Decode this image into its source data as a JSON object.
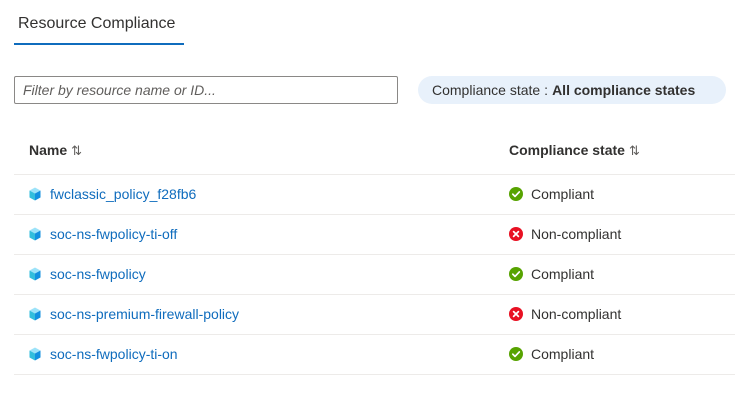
{
  "tabs": [
    {
      "label": "Resource Compliance",
      "active": true
    }
  ],
  "filter": {
    "placeholder": "Filter by resource name or ID...",
    "value": ""
  },
  "compliance_filter": {
    "label": "Compliance state",
    "separator": ":",
    "value": "All compliance states"
  },
  "table": {
    "columns": [
      {
        "label": "Name",
        "sort_icon": "⇅"
      },
      {
        "label": "Compliance state",
        "sort_icon": "⇅"
      }
    ],
    "rows": [
      {
        "name": "fwclassic_policy_f28fb6",
        "state": "Compliant",
        "status": "compliant"
      },
      {
        "name": "soc-ns-fwpolicy-ti-off",
        "state": "Non-compliant",
        "status": "non-compliant"
      },
      {
        "name": "soc-ns-fwpolicy",
        "state": "Compliant",
        "status": "compliant"
      },
      {
        "name": "soc-ns-premium-firewall-policy",
        "state": "Non-compliant",
        "status": "non-compliant"
      },
      {
        "name": "soc-ns-fwpolicy-ti-on",
        "state": "Compliant",
        "status": "compliant"
      }
    ]
  },
  "colors": {
    "accent": "#0f6cbd",
    "compliant": "#57a300",
    "non_compliant": "#e81123",
    "pill_bg": "#e8f1fb"
  },
  "icons": {
    "resource": "firewall-policy-cube-icon",
    "compliant": "check-circle-icon",
    "non_compliant": "error-circle-icon"
  }
}
